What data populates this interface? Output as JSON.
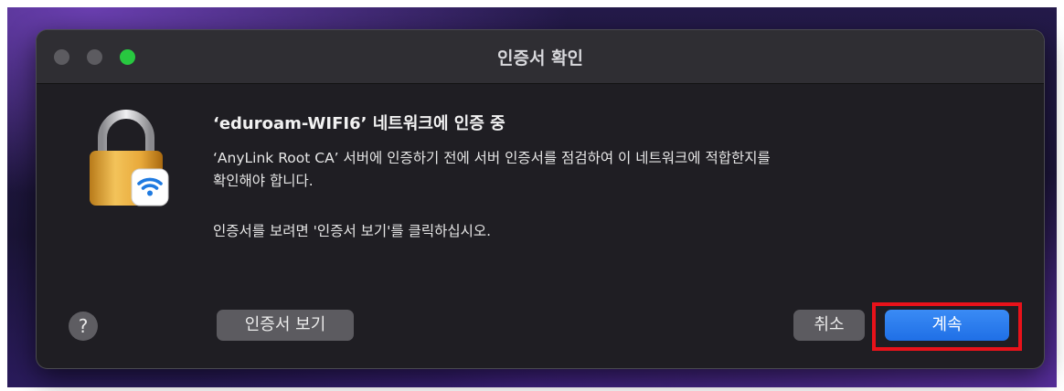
{
  "window": {
    "title": "인증서 확인"
  },
  "dialog": {
    "heading": "‘eduroam-WIFI6’ 네트워크에 인증 중",
    "message_line1": "‘AnyLink Root CA’ 서버에 인증하기 전에 서버 인증서를 점검하여 이 네트워크에 적합한지를",
    "message_line2": "확인해야 합니다.",
    "instruction": "인증서를 보려면 '인증서 보기'를 클릭하십시오."
  },
  "buttons": {
    "help": "?",
    "view_certificate": "인증서 보기",
    "cancel": "취소",
    "continue": "계속"
  },
  "icons": {
    "main": "wifi-lock-icon"
  },
  "colors": {
    "accent": "#1f6fe6",
    "highlight": "#e8121a",
    "window_bg": "#1f1e23",
    "traffic_green": "#28c840"
  }
}
